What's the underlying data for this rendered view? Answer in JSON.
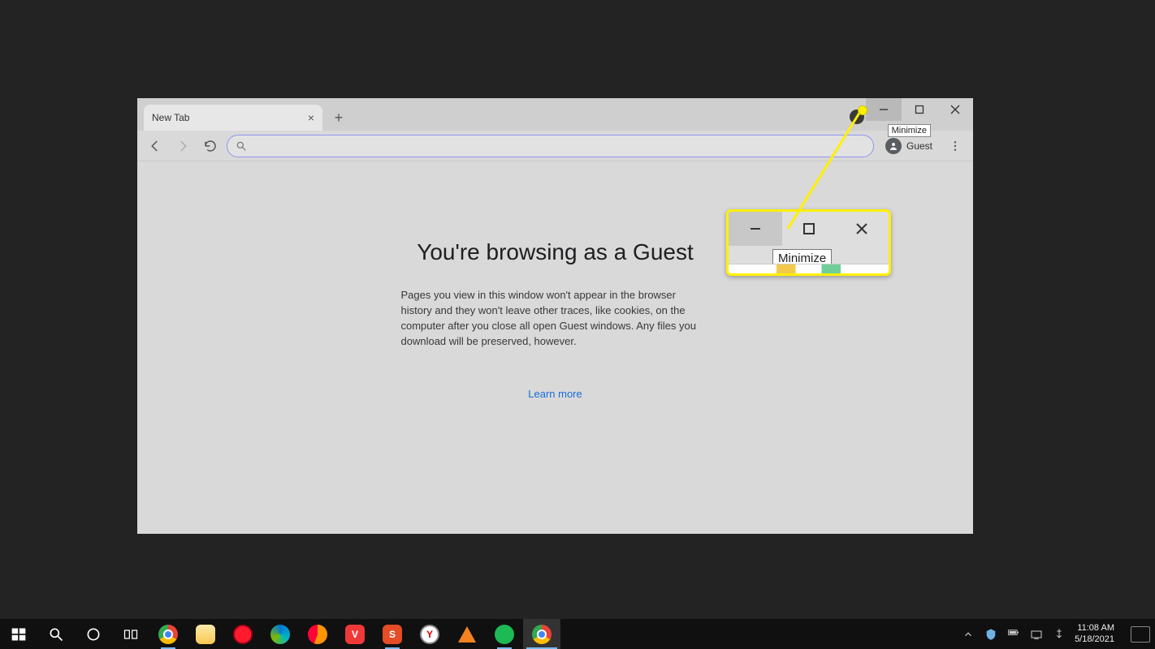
{
  "browser": {
    "tab_title": "New Tab",
    "window_tooltip": "Minimize",
    "toolbar": {
      "guest_label": "Guest",
      "omnibox_placeholder": ""
    },
    "page": {
      "heading": "You're browsing as a Guest",
      "body": "Pages you view in this window won't appear in the browser history and they won't leave other traces, like cookies, on the computer after you close all open Guest windows. Any files you download will be preserved, however.",
      "learn_more": "Learn more"
    }
  },
  "callout": {
    "tooltip": "Minimize"
  },
  "taskbar": {
    "time": "11:08 AM",
    "date": "5/18/2021",
    "apps": [
      "chrome",
      "explorer",
      "opera",
      "edge",
      "firefox",
      "vivaldi",
      "snagit",
      "yandex",
      "vlc",
      "spotify",
      "chrome-guest"
    ]
  }
}
